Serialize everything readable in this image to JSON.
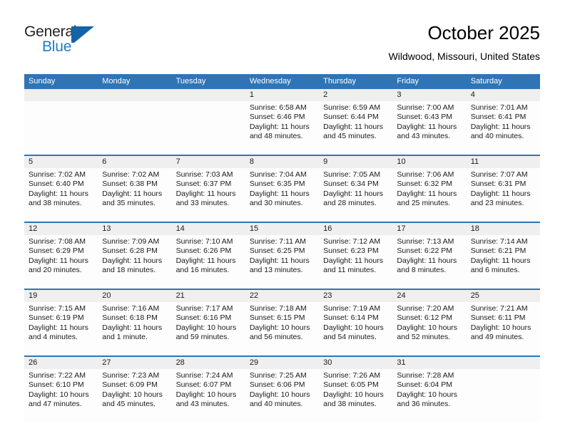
{
  "brand": {
    "name_part1": "General",
    "name_part2": "Blue",
    "flag_icon": "flag-triangle-icon"
  },
  "header": {
    "title": "October 2025",
    "subtitle": "Wildwood, Missouri, United States"
  },
  "colors": {
    "header_blue": "#2f75b5",
    "daynum_gray": "#efefef",
    "brand_blue": "#1d7fc3",
    "flag_blue": "#1464a5"
  },
  "weekday_headers": [
    "Sunday",
    "Monday",
    "Tuesday",
    "Wednesday",
    "Thursday",
    "Friday",
    "Saturday"
  ],
  "weeks": [
    [
      {
        "day": "",
        "lines": []
      },
      {
        "day": "",
        "lines": []
      },
      {
        "day": "",
        "lines": []
      },
      {
        "day": "1",
        "lines": [
          "Sunrise: 6:58 AM",
          "Sunset: 6:46 PM",
          "Daylight: 11 hours",
          "and 48 minutes."
        ]
      },
      {
        "day": "2",
        "lines": [
          "Sunrise: 6:59 AM",
          "Sunset: 6:44 PM",
          "Daylight: 11 hours",
          "and 45 minutes."
        ]
      },
      {
        "day": "3",
        "lines": [
          "Sunrise: 7:00 AM",
          "Sunset: 6:43 PM",
          "Daylight: 11 hours",
          "and 43 minutes."
        ]
      },
      {
        "day": "4",
        "lines": [
          "Sunrise: 7:01 AM",
          "Sunset: 6:41 PM",
          "Daylight: 11 hours",
          "and 40 minutes."
        ]
      }
    ],
    [
      {
        "day": "5",
        "lines": [
          "Sunrise: 7:02 AM",
          "Sunset: 6:40 PM",
          "Daylight: 11 hours",
          "and 38 minutes."
        ]
      },
      {
        "day": "6",
        "lines": [
          "Sunrise: 7:02 AM",
          "Sunset: 6:38 PM",
          "Daylight: 11 hours",
          "and 35 minutes."
        ]
      },
      {
        "day": "7",
        "lines": [
          "Sunrise: 7:03 AM",
          "Sunset: 6:37 PM",
          "Daylight: 11 hours",
          "and 33 minutes."
        ]
      },
      {
        "day": "8",
        "lines": [
          "Sunrise: 7:04 AM",
          "Sunset: 6:35 PM",
          "Daylight: 11 hours",
          "and 30 minutes."
        ]
      },
      {
        "day": "9",
        "lines": [
          "Sunrise: 7:05 AM",
          "Sunset: 6:34 PM",
          "Daylight: 11 hours",
          "and 28 minutes."
        ]
      },
      {
        "day": "10",
        "lines": [
          "Sunrise: 7:06 AM",
          "Sunset: 6:32 PM",
          "Daylight: 11 hours",
          "and 25 minutes."
        ]
      },
      {
        "day": "11",
        "lines": [
          "Sunrise: 7:07 AM",
          "Sunset: 6:31 PM",
          "Daylight: 11 hours",
          "and 23 minutes."
        ]
      }
    ],
    [
      {
        "day": "12",
        "lines": [
          "Sunrise: 7:08 AM",
          "Sunset: 6:29 PM",
          "Daylight: 11 hours",
          "and 20 minutes."
        ]
      },
      {
        "day": "13",
        "lines": [
          "Sunrise: 7:09 AM",
          "Sunset: 6:28 PM",
          "Daylight: 11 hours",
          "and 18 minutes."
        ]
      },
      {
        "day": "14",
        "lines": [
          "Sunrise: 7:10 AM",
          "Sunset: 6:26 PM",
          "Daylight: 11 hours",
          "and 16 minutes."
        ]
      },
      {
        "day": "15",
        "lines": [
          "Sunrise: 7:11 AM",
          "Sunset: 6:25 PM",
          "Daylight: 11 hours",
          "and 13 minutes."
        ]
      },
      {
        "day": "16",
        "lines": [
          "Sunrise: 7:12 AM",
          "Sunset: 6:23 PM",
          "Daylight: 11 hours",
          "and 11 minutes."
        ]
      },
      {
        "day": "17",
        "lines": [
          "Sunrise: 7:13 AM",
          "Sunset: 6:22 PM",
          "Daylight: 11 hours",
          "and 8 minutes."
        ]
      },
      {
        "day": "18",
        "lines": [
          "Sunrise: 7:14 AM",
          "Sunset: 6:21 PM",
          "Daylight: 11 hours",
          "and 6 minutes."
        ]
      }
    ],
    [
      {
        "day": "19",
        "lines": [
          "Sunrise: 7:15 AM",
          "Sunset: 6:19 PM",
          "Daylight: 11 hours",
          "and 4 minutes."
        ]
      },
      {
        "day": "20",
        "lines": [
          "Sunrise: 7:16 AM",
          "Sunset: 6:18 PM",
          "Daylight: 11 hours",
          "and 1 minute."
        ]
      },
      {
        "day": "21",
        "lines": [
          "Sunrise: 7:17 AM",
          "Sunset: 6:16 PM",
          "Daylight: 10 hours",
          "and 59 minutes."
        ]
      },
      {
        "day": "22",
        "lines": [
          "Sunrise: 7:18 AM",
          "Sunset: 6:15 PM",
          "Daylight: 10 hours",
          "and 56 minutes."
        ]
      },
      {
        "day": "23",
        "lines": [
          "Sunrise: 7:19 AM",
          "Sunset: 6:14 PM",
          "Daylight: 10 hours",
          "and 54 minutes."
        ]
      },
      {
        "day": "24",
        "lines": [
          "Sunrise: 7:20 AM",
          "Sunset: 6:12 PM",
          "Daylight: 10 hours",
          "and 52 minutes."
        ]
      },
      {
        "day": "25",
        "lines": [
          "Sunrise: 7:21 AM",
          "Sunset: 6:11 PM",
          "Daylight: 10 hours",
          "and 49 minutes."
        ]
      }
    ],
    [
      {
        "day": "26",
        "lines": [
          "Sunrise: 7:22 AM",
          "Sunset: 6:10 PM",
          "Daylight: 10 hours",
          "and 47 minutes."
        ]
      },
      {
        "day": "27",
        "lines": [
          "Sunrise: 7:23 AM",
          "Sunset: 6:09 PM",
          "Daylight: 10 hours",
          "and 45 minutes."
        ]
      },
      {
        "day": "28",
        "lines": [
          "Sunrise: 7:24 AM",
          "Sunset: 6:07 PM",
          "Daylight: 10 hours",
          "and 43 minutes."
        ]
      },
      {
        "day": "29",
        "lines": [
          "Sunrise: 7:25 AM",
          "Sunset: 6:06 PM",
          "Daylight: 10 hours",
          "and 40 minutes."
        ]
      },
      {
        "day": "30",
        "lines": [
          "Sunrise: 7:26 AM",
          "Sunset: 6:05 PM",
          "Daylight: 10 hours",
          "and 38 minutes."
        ]
      },
      {
        "day": "31",
        "lines": [
          "Sunrise: 7:28 AM",
          "Sunset: 6:04 PM",
          "Daylight: 10 hours",
          "and 36 minutes."
        ]
      },
      {
        "day": "",
        "lines": []
      }
    ]
  ]
}
